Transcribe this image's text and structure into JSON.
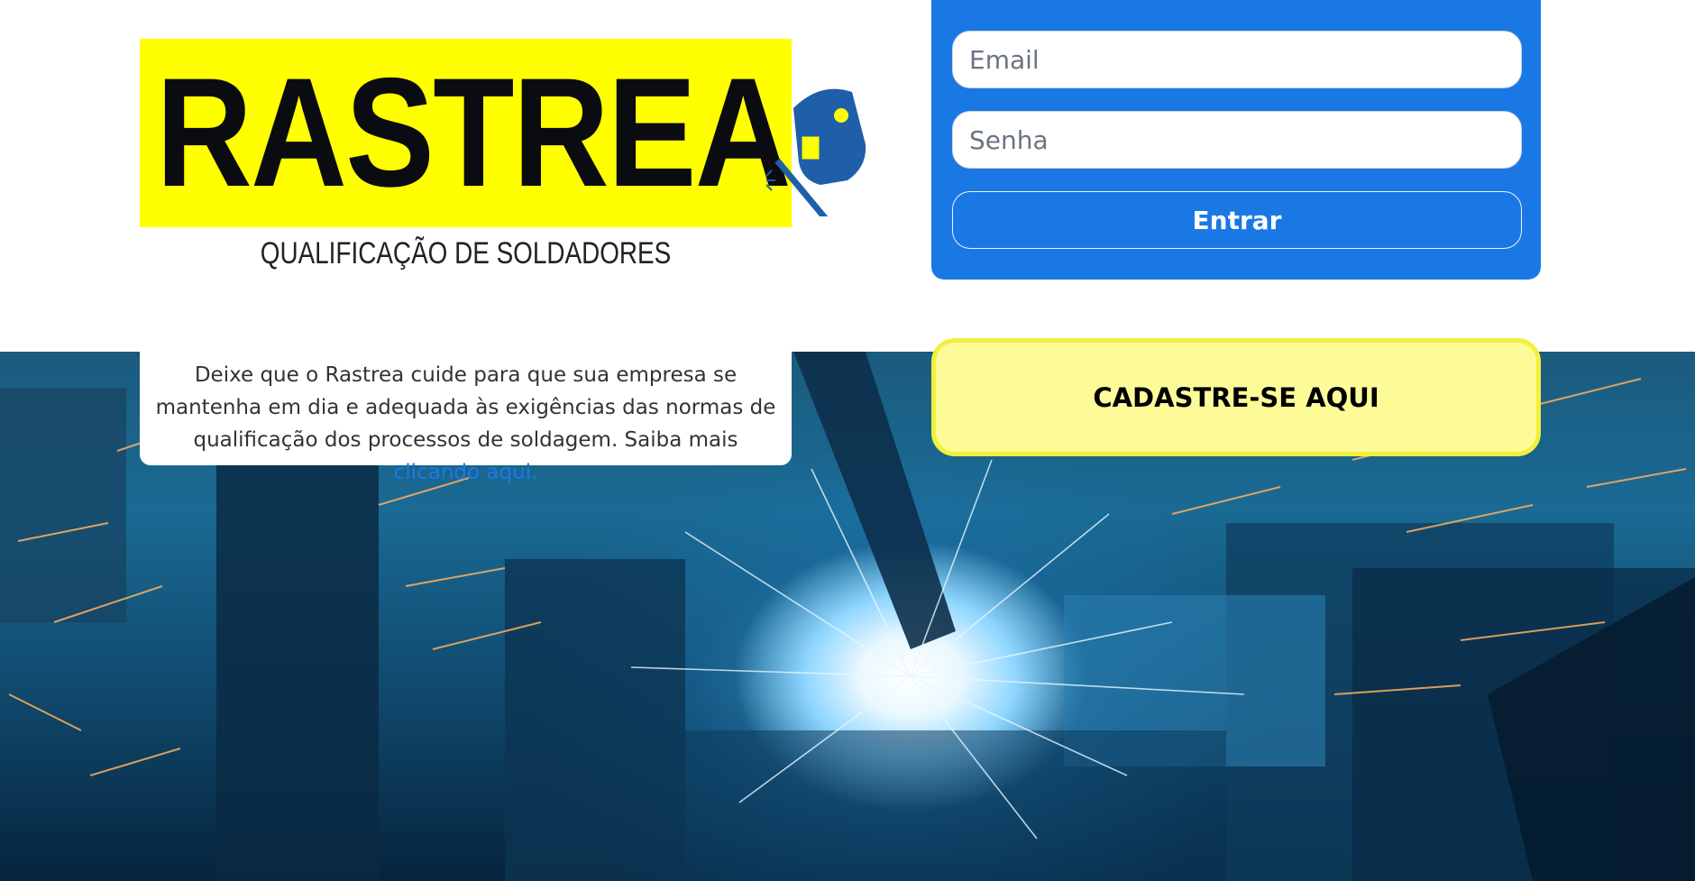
{
  "logo": {
    "wordmark": "RASTREA",
    "tagline": "QUALIFICAÇÃO DE SOLDADORES",
    "colors": {
      "background": "#ffff00",
      "text": "#0b0b12",
      "helmet": "#1f5ea8"
    }
  },
  "intro": {
    "text": "Deixe que o Rastrea cuide para que sua empresa se mantenha em dia e adequada às exigências das normas de qualificação dos processos de soldagem. Saiba mais ",
    "link_label": "clicando aqui."
  },
  "login": {
    "email_placeholder": "Email",
    "password_placeholder": "Senha",
    "submit_label": "Entrar",
    "accent_color": "#1a78e5"
  },
  "register": {
    "label": "CADASTRE-SE AQUI",
    "background_color": "#fdfb98",
    "border_color": "#f2f03a"
  }
}
